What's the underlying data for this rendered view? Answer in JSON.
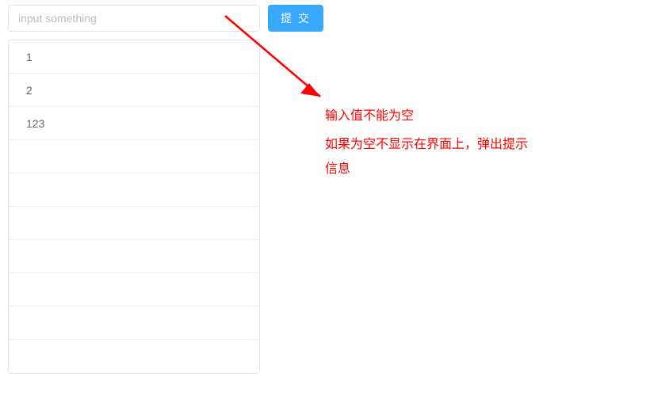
{
  "colors": {
    "accent": "#38a8ff",
    "annotation": "#ff0000",
    "border": "#e5e5e5"
  },
  "input": {
    "placeholder": "input something",
    "value": ""
  },
  "submit": {
    "label": "提 交"
  },
  "list": {
    "items": [
      "1",
      "2",
      "123",
      "",
      "",
      "",
      "",
      "",
      "",
      ""
    ]
  },
  "annotation": {
    "line1": "输入值不能为空",
    "line2": "如果为空不显示在界面上，弹出提示信息"
  }
}
